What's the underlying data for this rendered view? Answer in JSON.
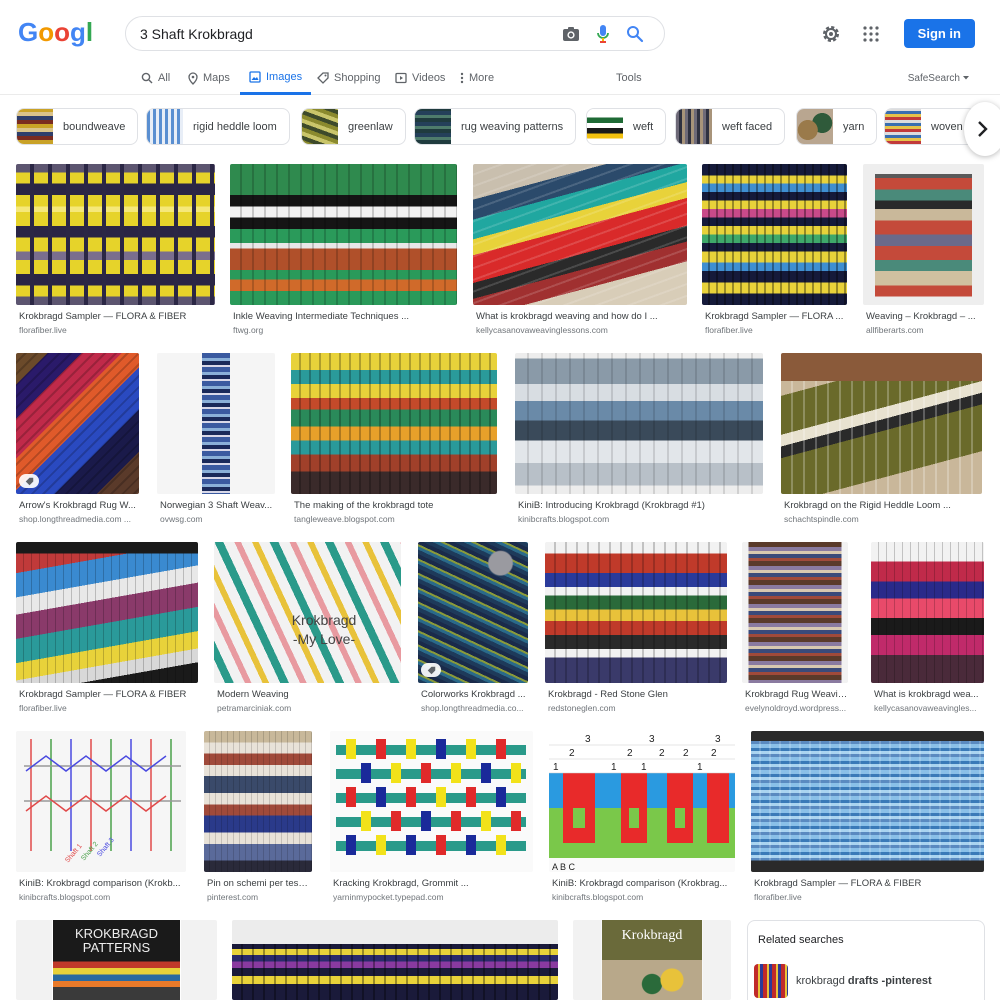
{
  "logo": {
    "text": "Google"
  },
  "search": {
    "query": "3 Shaft Krokbragd"
  },
  "header": {
    "sign_in": "Sign in"
  },
  "nav": {
    "all": "All",
    "maps": "Maps",
    "images": "Images",
    "shopping": "Shopping",
    "videos": "Videos",
    "more": "More",
    "tools": "Tools",
    "safesearch": "SafeSearch"
  },
  "chips": [
    {
      "label": "boundweave"
    },
    {
      "label": "rigid heddle loom"
    },
    {
      "label": "greenlaw"
    },
    {
      "label": "rug weaving patterns"
    },
    {
      "label": "weft"
    },
    {
      "label": "weft faced"
    },
    {
      "label": "yarn"
    },
    {
      "label": "woven"
    }
  ],
  "results": [
    {
      "title": "Krokbragd Sampler — FLORA & FIBER",
      "source": "florafiber.live"
    },
    {
      "title": "Inkle Weaving Intermediate Techniques ...",
      "source": "ftwg.org"
    },
    {
      "title": "What is krokbragd weaving and how do I ...",
      "source": "kellycasanovaweavinglessons.com"
    },
    {
      "title": "Krokbragd Sampler — FLORA ...",
      "source": "florafiber.live"
    },
    {
      "title": "Weaving – Krokbragd – ...",
      "source": "allfiberarts.com"
    },
    {
      "title": "Arrow's Krokbragd Rug W...",
      "source": "shop.longthreadmedia.com ..."
    },
    {
      "title": "Norwegian 3 Shaft Weav...",
      "source": "ovwsg.com"
    },
    {
      "title": "The making of the krokbragd tote",
      "source": "tangleweave.blogspot.com"
    },
    {
      "title": "KiniB: Introducing Krokbragd (Krokbragd #1)",
      "source": "kinibcrafts.blogspot.com"
    },
    {
      "title": "Krokbragd on the Rigid Heddle Loom ...",
      "source": "schachtspindle.com"
    },
    {
      "title": "Krokbragd Sampler — FLORA & FIBER",
      "source": "florafiber.live"
    },
    {
      "title": "Modern Weaving",
      "source": "petramarciniak.com"
    },
    {
      "title": "Colorworks Krokbragd ...",
      "source": "shop.longthreadmedia.co..."
    },
    {
      "title": "Krokbragd - Red Stone Glen",
      "source": "redstoneglen.com"
    },
    {
      "title": "Krokbragd Rug Weavin...",
      "source": "evelynoldroyd.wordpress..."
    },
    {
      "title": "What is krokbragd wea...",
      "source": "kellycasanovaweavingles..."
    },
    {
      "title": "KiniB: Krokbragd comparison (Krokb...",
      "source": "kinibcrafts.blogspot.com"
    },
    {
      "title": "Pin on schemi per tessi...",
      "source": "pinterest.com"
    },
    {
      "title": "Kracking Krokbragd, Grommit ...",
      "source": "yarninmypocket.typepad.com"
    },
    {
      "title": "KiniB: Krokbragd comparison (Krokbrag...",
      "source": "kinibcrafts.blogspot.com"
    },
    {
      "title": "Krokbragd Sampler — FLORA & FIBER",
      "source": "florafiber.live"
    }
  ],
  "image_text": {
    "modern_weaving_1": "Krokbragd",
    "modern_weaving_2": "-My Love-",
    "patterns_1": "KROKBRAGD",
    "patterns_2": "PATTERNS",
    "book_cover": "Krokbragd",
    "diagram_shaft1": "Shaft 1",
    "diagram_shaft2": "Shaft 2",
    "diagram_shaft3": "Shaft 3",
    "chart_cols": "A B C"
  },
  "related": {
    "heading": "Related searches",
    "item_prefix": "krokbragd",
    "item_bold": "drafts -pinterest"
  },
  "colors": {
    "accent": "#1a73e8",
    "border": "#dfe1e5"
  }
}
